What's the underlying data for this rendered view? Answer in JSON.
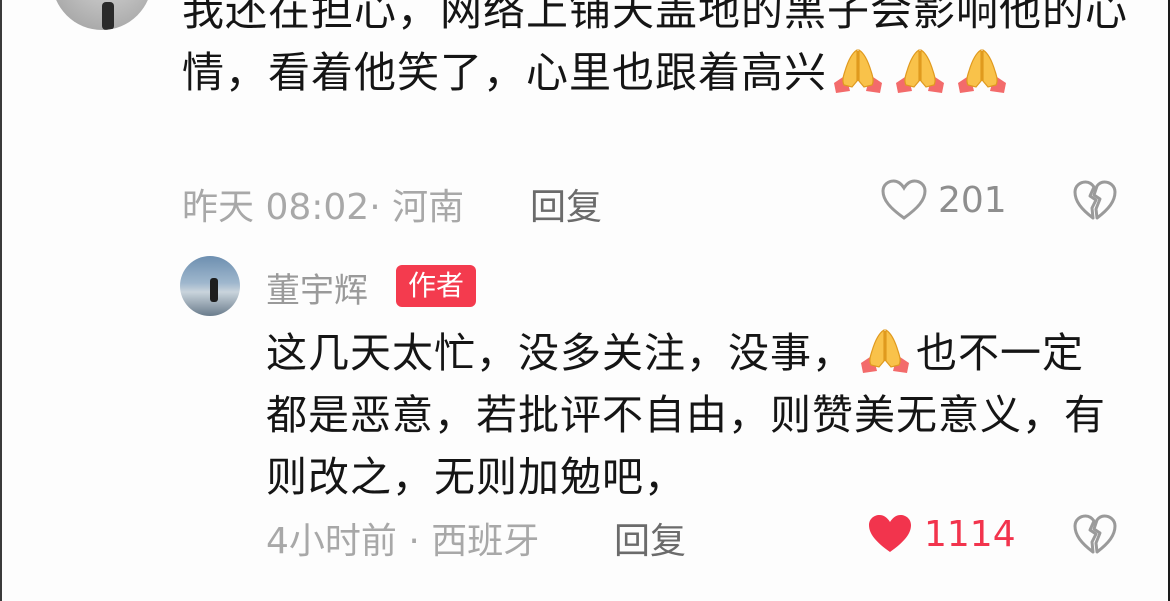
{
  "parent_comment": {
    "text_part1": "我还在担心，网络上铺天盖地的黑子会影响他的心情，看着他笑了，心里也跟着高兴",
    "emoji": "folded-hands",
    "meta": "昨天 08:02· 河南",
    "reply_label": "回复",
    "like_count": "201",
    "liked": false
  },
  "reply_comment": {
    "author_name": "董宇辉",
    "author_badge": "作者",
    "text_part1": "这几天太忙，没多关注，没事，",
    "emoji": "folded-hands",
    "text_part2": "也不一定都是恶意，若批评不自由，则赞美无意义，有则改之，无则加勉吧，",
    "meta": "4小时前 · 西班牙",
    "reply_label": "回复",
    "like_count": "1114",
    "liked": true
  },
  "colors": {
    "like_active": "#f2344d",
    "badge": "#f43b4e",
    "meta_text": "#a8a8a8",
    "body_text": "#151515"
  },
  "icons": [
    "heart-outline-icon",
    "heart-filled-icon",
    "broken-heart-icon",
    "folded-hands-emoji"
  ]
}
